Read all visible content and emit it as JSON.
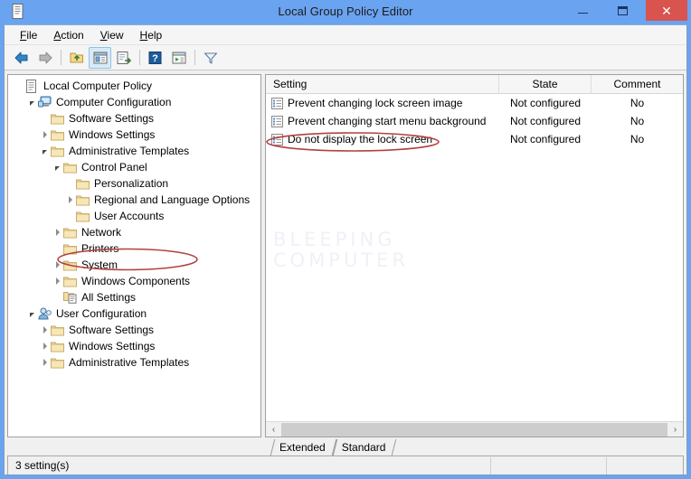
{
  "window": {
    "title": "Local Group Policy Editor",
    "icon": "policy-document-icon",
    "accent_title_bg": "#6aa3f0",
    "close_button_bg": "#d9534f",
    "controls": {
      "minimize": "minimize-button",
      "maximize": "maximize-button",
      "close": "close-button",
      "close_glyph": "✕"
    }
  },
  "menubar": {
    "items": [
      {
        "accel": "F",
        "rest": "ile"
      },
      {
        "accel": "A",
        "rest": "ction"
      },
      {
        "accel": "V",
        "rest": "iew"
      },
      {
        "accel": "H",
        "rest": "elp"
      }
    ]
  },
  "toolbar": {
    "buttons": [
      {
        "name": "back-button",
        "icon": "arrow-left-icon",
        "active": false
      },
      {
        "name": "forward-button",
        "icon": "arrow-right-icon",
        "active": false
      },
      {
        "name": "up-one-level-button",
        "icon": "folder-up-icon",
        "active": false
      },
      {
        "name": "show-hide-console-tree-button",
        "icon": "console-tree-icon",
        "active": true
      },
      {
        "name": "export-list-button",
        "icon": "export-list-icon",
        "active": false
      },
      {
        "name": "help-button",
        "icon": "question-mark-icon",
        "active": false
      },
      {
        "name": "properties-button",
        "icon": "properties-window-icon",
        "active": false
      },
      {
        "name": "filter-button",
        "icon": "funnel-filter-icon",
        "active": false
      }
    ]
  },
  "tree": {
    "items": [
      {
        "label": "Local Computer Policy",
        "indent": 0,
        "twisty": "none",
        "icon": "policy-document-icon",
        "highlighted": false
      },
      {
        "label": "Computer Configuration",
        "indent": 1,
        "twisty": "open",
        "icon": "computer-icon",
        "highlighted": false
      },
      {
        "label": "Software Settings",
        "indent": 2,
        "twisty": "none",
        "icon": "folder-icon",
        "highlighted": false
      },
      {
        "label": "Windows Settings",
        "indent": 2,
        "twisty": "closed",
        "icon": "folder-icon",
        "highlighted": false
      },
      {
        "label": "Administrative Templates",
        "indent": 2,
        "twisty": "open",
        "icon": "folder-icon",
        "highlighted": false
      },
      {
        "label": "Control Panel",
        "indent": 3,
        "twisty": "open",
        "icon": "folder-icon",
        "highlighted": false
      },
      {
        "label": "Personalization",
        "indent": 4,
        "twisty": "none",
        "icon": "folder-icon",
        "highlighted": true
      },
      {
        "label": "Regional and Language Options",
        "indent": 4,
        "twisty": "closed",
        "icon": "folder-icon",
        "highlighted": false
      },
      {
        "label": "User Accounts",
        "indent": 4,
        "twisty": "none",
        "icon": "folder-icon",
        "highlighted": false
      },
      {
        "label": "Network",
        "indent": 3,
        "twisty": "closed",
        "icon": "folder-icon",
        "highlighted": false
      },
      {
        "label": "Printers",
        "indent": 3,
        "twisty": "none",
        "icon": "folder-icon",
        "highlighted": false
      },
      {
        "label": "System",
        "indent": 3,
        "twisty": "closed",
        "icon": "folder-icon",
        "highlighted": false
      },
      {
        "label": "Windows Components",
        "indent": 3,
        "twisty": "closed",
        "icon": "folder-icon",
        "highlighted": false
      },
      {
        "label": "All Settings",
        "indent": 3,
        "twisty": "none",
        "icon": "all-settings-icon",
        "highlighted": false
      },
      {
        "label": "User Configuration",
        "indent": 1,
        "twisty": "open",
        "icon": "user-icon",
        "highlighted": false
      },
      {
        "label": "Software Settings",
        "indent": 2,
        "twisty": "closed",
        "icon": "folder-icon",
        "highlighted": false
      },
      {
        "label": "Windows Settings",
        "indent": 2,
        "twisty": "closed",
        "icon": "folder-icon",
        "highlighted": false
      },
      {
        "label": "Administrative Templates",
        "indent": 2,
        "twisty": "closed",
        "icon": "folder-icon",
        "highlighted": false
      }
    ]
  },
  "list": {
    "columns": [
      "Setting",
      "State",
      "Comment"
    ],
    "rows": [
      {
        "setting": "Prevent changing lock screen image",
        "state": "Not configured",
        "comment": "No",
        "highlighted": false
      },
      {
        "setting": "Prevent changing start menu background",
        "state": "Not configured",
        "comment": "No",
        "highlighted": false
      },
      {
        "setting": "Do not display the lock screen",
        "state": "Not configured",
        "comment": "No",
        "highlighted": true
      }
    ],
    "watermark_line1": "BLEEPING",
    "watermark_line2": "COMPUTER"
  },
  "scrollbar": {
    "left_arrow": "‹",
    "right_arrow": "›"
  },
  "tabs": {
    "items": [
      {
        "label": "Extended",
        "selected": false
      },
      {
        "label": "Standard",
        "selected": true
      }
    ]
  },
  "statusbar": {
    "cells": [
      "3 setting(s)",
      "",
      ""
    ]
  },
  "annotations": {
    "ellipse_color": "#b3413f",
    "tree_ellipse_target": "Personalization",
    "list_ellipse_target": "Do not display the lock screen"
  }
}
